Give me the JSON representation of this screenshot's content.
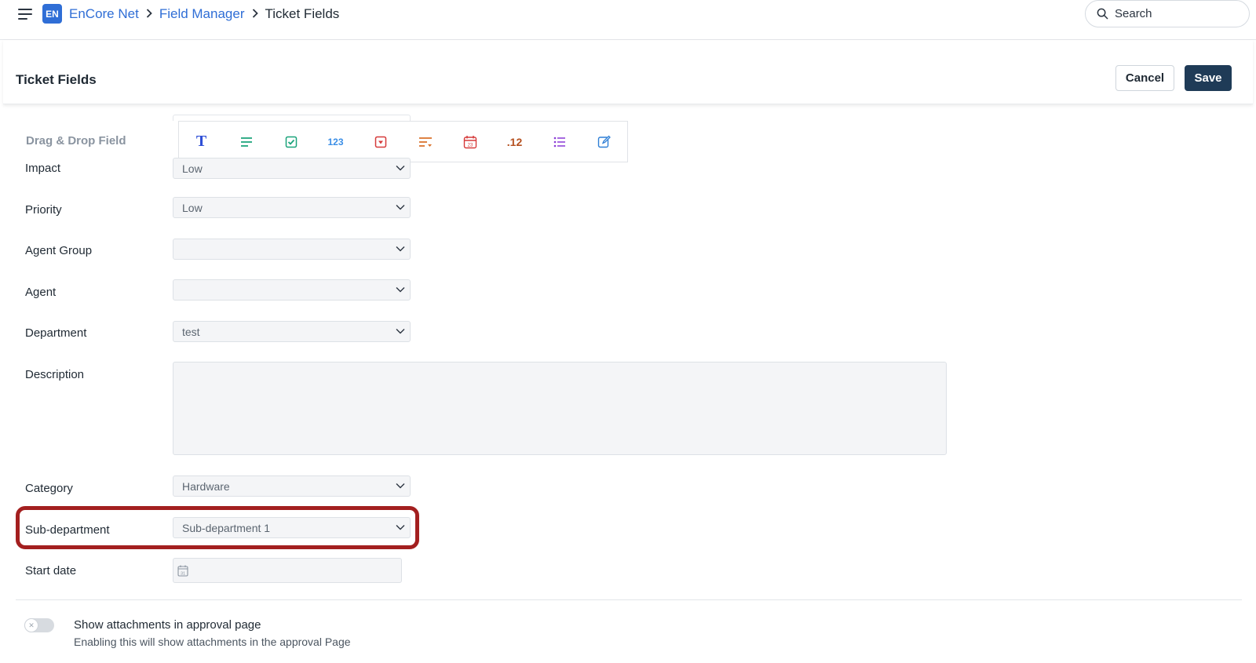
{
  "app": {
    "logo": "EN",
    "breadcrumb": [
      "EnCore Net",
      "Field Manager",
      "Ticket Fields"
    ]
  },
  "search": {
    "placeholder": "Search"
  },
  "header": {
    "title": "Ticket Fields",
    "cancel_label": "Cancel",
    "save_label": "Save"
  },
  "palette": {
    "label": "Drag & Drop Field",
    "items": [
      {
        "icon": "text-field-icon",
        "glyph": "T",
        "color": "#2f4fd6"
      },
      {
        "icon": "paragraph-icon",
        "color": "#1aa37a"
      },
      {
        "icon": "checkbox-icon",
        "color": "#1aa37a"
      },
      {
        "icon": "number-icon",
        "glyph": "123",
        "color": "#3a8ee6"
      },
      {
        "icon": "dropdown-icon",
        "color": "#d63a3a"
      },
      {
        "icon": "multi-select-icon",
        "color": "#d9702a"
      },
      {
        "icon": "date-icon",
        "glyph": "23",
        "color": "#d63a3a"
      },
      {
        "icon": "decimal-icon",
        "glyph": ".12",
        "color": "#b5501f"
      },
      {
        "icon": "list-icon",
        "color": "#8a3ad6"
      },
      {
        "icon": "edit-icon",
        "color": "#2f7fd6"
      }
    ]
  },
  "form": {
    "impact": {
      "label": "Impact",
      "value": "Low"
    },
    "priority": {
      "label": "Priority",
      "value": "Low"
    },
    "agent_group": {
      "label": "Agent Group",
      "value": ""
    },
    "agent": {
      "label": "Agent",
      "value": ""
    },
    "department": {
      "label": "Department",
      "value": "test"
    },
    "description": {
      "label": "Description",
      "value": ""
    },
    "category": {
      "label": "Category",
      "value": "Hardware"
    },
    "sub_department": {
      "label": "Sub-department",
      "value": "Sub-department 1"
    },
    "start_date": {
      "label": "Start date",
      "value": "",
      "calendar_glyph": "31"
    }
  },
  "attachments_toggle": {
    "title": "Show attachments in approval page",
    "description": "Enabling this will show attachments in the approval Page",
    "enabled": false
  },
  "colors": {
    "accent": "#2f6ed6",
    "primary_button": "#1f3b57",
    "highlight": "#a31f1f"
  }
}
